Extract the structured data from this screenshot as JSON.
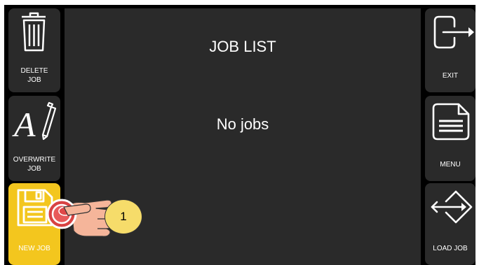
{
  "left_toolbar": {
    "delete_job": {
      "label_line1": "DELETE",
      "label_line2": "JOB",
      "icon": "trash-icon"
    },
    "overwrite_job": {
      "label_line1": "OVERWRITE",
      "label_line2": "JOB",
      "icon": "overwrite-icon"
    },
    "new_job": {
      "label": "NEW JOB",
      "icon": "floppy-disk-icon",
      "highlight_color": "#f3c61e"
    }
  },
  "right_toolbar": {
    "exit": {
      "label": "EXIT",
      "icon": "exit-icon"
    },
    "menu": {
      "label": "MENU",
      "icon": "menu-document-icon"
    },
    "load_job": {
      "label": "LOAD JOB",
      "icon": "load-job-icon"
    }
  },
  "main": {
    "title": "JOB LIST",
    "empty_message": "No jobs"
  },
  "annotation": {
    "step_number": "1",
    "pointer_icon": "pointing-hand-icon",
    "target_marker_color": "#e53935"
  }
}
